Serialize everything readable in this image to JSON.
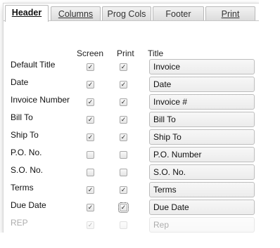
{
  "tabs": [
    {
      "label": "Header",
      "active": true
    },
    {
      "label": "Columns",
      "active": false
    },
    {
      "label": "Prog Cols",
      "active": false
    },
    {
      "label": "Footer",
      "active": false
    },
    {
      "label": "Print",
      "active": false
    }
  ],
  "columns": {
    "screen": "Screen",
    "print": "Print",
    "title": "Title"
  },
  "rows": [
    {
      "label": "Default Title",
      "screen": true,
      "print": true,
      "title": "Invoice"
    },
    {
      "label": "Date",
      "screen": true,
      "print": true,
      "title": "Date"
    },
    {
      "label": "Invoice Number",
      "screen": true,
      "print": true,
      "title": "Invoice #"
    },
    {
      "label": "Bill To",
      "screen": true,
      "print": true,
      "title": "Bill To"
    },
    {
      "label": "Ship To",
      "screen": true,
      "print": true,
      "title": "Ship To"
    },
    {
      "label": "P.O. No.",
      "screen": false,
      "print": false,
      "title": "P.O. Number"
    },
    {
      "label": "S.O. No.",
      "screen": false,
      "print": false,
      "title": "S.O. No."
    },
    {
      "label": "Terms",
      "screen": true,
      "print": true,
      "title": "Terms"
    },
    {
      "label": "Due Date",
      "screen": true,
      "print": true,
      "title": "Due Date"
    },
    {
      "label": "REP",
      "screen": true,
      "print": false,
      "title": "Rep"
    }
  ]
}
